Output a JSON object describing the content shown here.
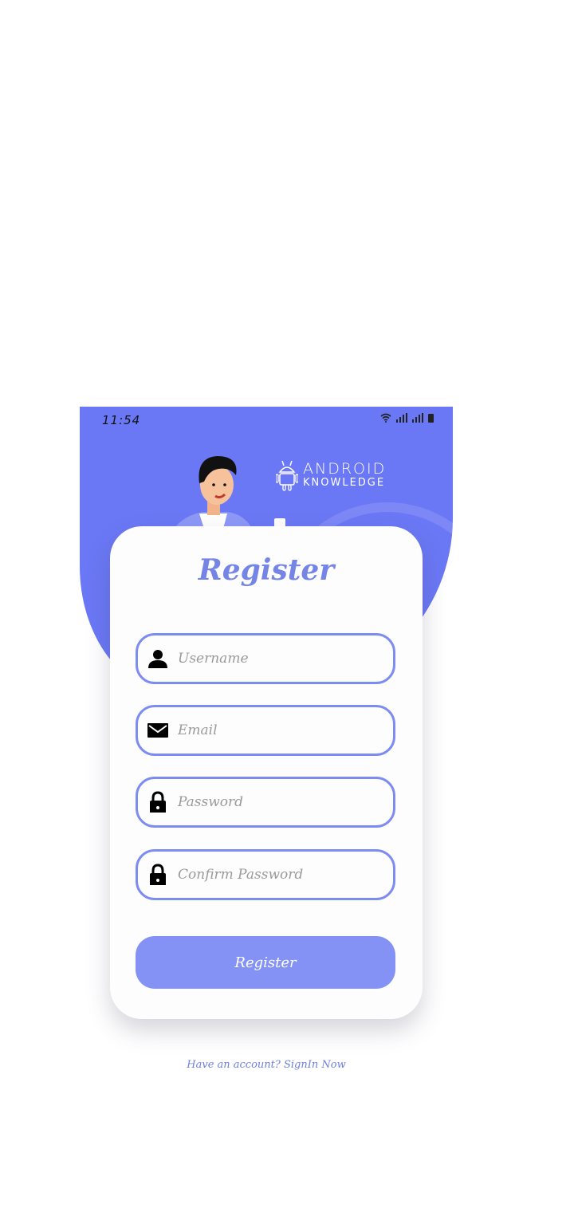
{
  "status_bar": {
    "time": "11:54"
  },
  "header": {
    "logo_line1": "ANDROID",
    "logo_line2": "KNOWLEDGE",
    "logo_icon": "android-robot-icon"
  },
  "form": {
    "title": "Register",
    "fields": [
      {
        "placeholder": "Username",
        "value": "",
        "icon": "person-icon"
      },
      {
        "placeholder": "Email",
        "value": "",
        "icon": "envelope-icon"
      },
      {
        "placeholder": "Password",
        "value": "",
        "icon": "lock-icon"
      },
      {
        "placeholder": "Confirm Password",
        "value": "",
        "icon": "lock-icon"
      }
    ],
    "submit_label": "Register"
  },
  "footer": {
    "signin_text": "Have an account? SignIn Now"
  },
  "colors": {
    "primary": "#6b78f5",
    "accent_border": "#7d8cf0",
    "button": "#8592f5",
    "title_text": "#7585e6"
  }
}
